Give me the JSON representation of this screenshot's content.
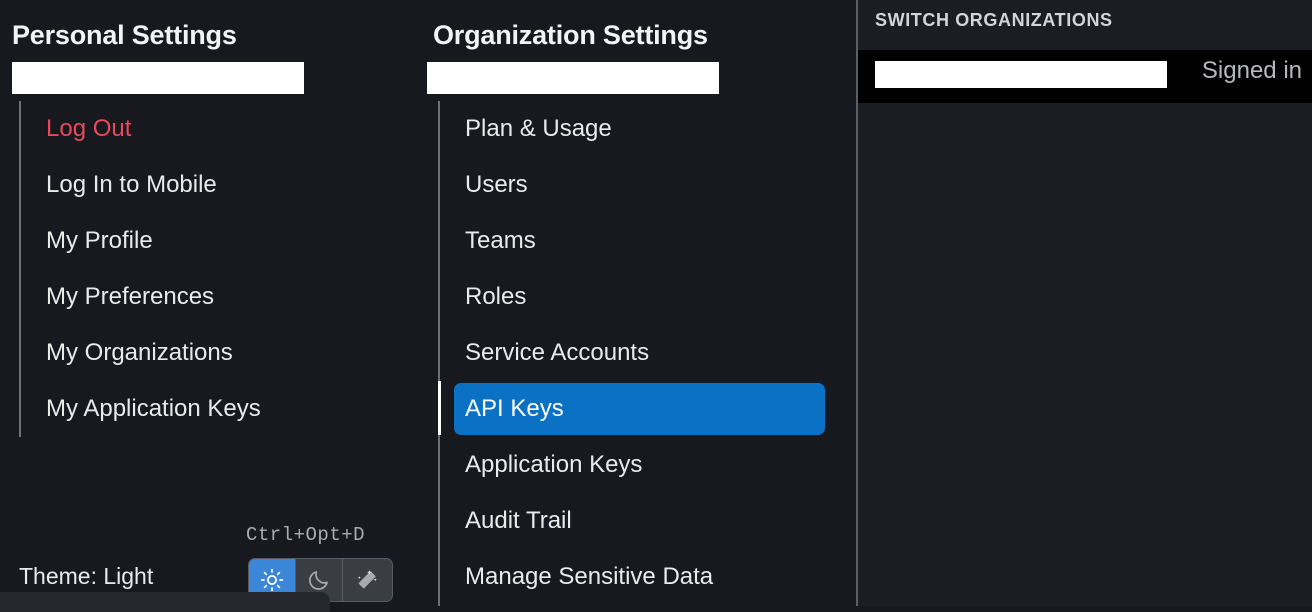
{
  "personal": {
    "title": "Personal Settings",
    "search_value": "",
    "items": [
      {
        "label": "Log Out",
        "style": "danger"
      },
      {
        "label": "Log In to Mobile",
        "style": "normal"
      },
      {
        "label": "My Profile",
        "style": "normal"
      },
      {
        "label": "My Preferences",
        "style": "normal"
      },
      {
        "label": "My Organizations",
        "style": "normal"
      },
      {
        "label": "My Application Keys",
        "style": "normal"
      }
    ],
    "theme": {
      "shortcut": "Ctrl+Opt+D",
      "label": "Theme: Light",
      "options": [
        {
          "icon": "sun-icon",
          "selected": true
        },
        {
          "icon": "moon-icon",
          "selected": false
        },
        {
          "icon": "magic-wand-icon",
          "selected": false
        }
      ]
    }
  },
  "organization": {
    "title": "Organization Settings",
    "search_value": "",
    "items": [
      {
        "label": "Plan & Usage",
        "active": false
      },
      {
        "label": "Users",
        "active": false
      },
      {
        "label": "Teams",
        "active": false
      },
      {
        "label": "Roles",
        "active": false
      },
      {
        "label": "Service Accounts",
        "active": false
      },
      {
        "label": "API Keys",
        "active": true
      },
      {
        "label": "Application Keys",
        "active": false
      },
      {
        "label": "Audit Trail",
        "active": false
      },
      {
        "label": "Manage Sensitive Data",
        "active": false
      }
    ]
  },
  "switch_organizations": {
    "title": "SWITCH ORGANIZATIONS",
    "current_org_name": "",
    "status": "Signed in"
  },
  "colors": {
    "background": "#17191e",
    "panel_background": "#1b1d22",
    "accent_blue": "#0a71c5",
    "toggle_blue": "#3b86d6",
    "danger_red": "#e8485c",
    "rail_grey": "#6e7076",
    "text": "#e9eaec"
  }
}
